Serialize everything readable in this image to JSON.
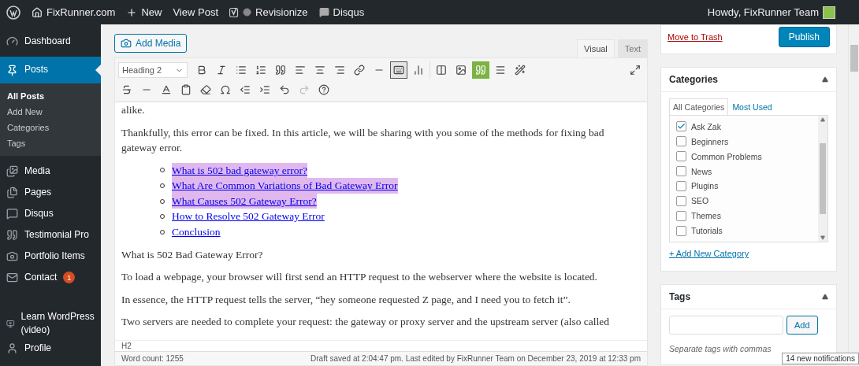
{
  "admin_bar": {
    "site": "FixRunner.com",
    "items": [
      "New",
      "View Post",
      "Revisionize",
      "Disqus"
    ],
    "greeting": "Howdy, FixRunner Team"
  },
  "sidebar": {
    "items": [
      {
        "label": "Dashboard",
        "selected": false
      },
      {
        "label": "Posts",
        "selected": true,
        "children": [
          {
            "label": "All Posts",
            "selected": true
          },
          {
            "label": "Add New",
            "selected": false
          },
          {
            "label": "Categories",
            "selected": false
          },
          {
            "label": "Tags",
            "selected": false
          }
        ]
      },
      {
        "label": "Media",
        "selected": false
      },
      {
        "label": "Pages",
        "selected": false
      },
      {
        "label": "Disqus",
        "selected": false
      },
      {
        "label": "Testimonial Pro",
        "selected": false
      },
      {
        "label": "Portfolio Items",
        "selected": false
      },
      {
        "label": "Contact",
        "selected": false,
        "badge": "1"
      },
      {
        "label": "Learn WordPress (video)",
        "selected": false
      },
      {
        "label": "Profile",
        "selected": false
      }
    ]
  },
  "editor": {
    "add_media": "Add Media",
    "tabs": [
      {
        "label": "Visual",
        "selected": true
      },
      {
        "label": "Text",
        "selected": false
      }
    ],
    "format": "Heading 2",
    "content": [
      {
        "kind": "p",
        "text": "alike."
      },
      {
        "kind": "p",
        "text": "Thankfully, this error can be fixed. In this article, we will be sharing with you some of the methods for fixing bad gateway error."
      },
      {
        "kind": "list",
        "items": [
          {
            "text": "What is 502 bad gateway error?",
            "highlighted": true
          },
          {
            "text": "What Are Common Variations of Bad Gateway Error",
            "highlighted": true
          },
          {
            "text": "What Causes 502 Gateway Error?",
            "highlighted": true
          },
          {
            "text": "How to Resolve 502 Gateway Error",
            "highlighted": false
          },
          {
            "text": "Conclusion",
            "highlighted": false
          }
        ]
      },
      {
        "kind": "p",
        "text": "What is 502 Bad Gateway Error?"
      },
      {
        "kind": "p",
        "text": "To load a webpage, your browser will first send an HTTP request to the webserver where the website is located."
      },
      {
        "kind": "p",
        "text": "In essence, the HTTP request tells the server, “hey someone requested Z page, and I need you to fetch it”."
      },
      {
        "kind": "p",
        "text": "Two servers are needed to complete your request: the gateway or proxy server and the upstream server (also called"
      }
    ],
    "path": "H2",
    "word_count": "Word count: 1255",
    "draft_status": "Draft saved at 2:04:47 pm. Last edited by FixRunner Team on December 23, 2019 at 12:33 pm"
  },
  "publish": {
    "trash": "Move to Trash",
    "button": "Publish"
  },
  "categories": {
    "title": "Categories",
    "tabs": [
      {
        "label": "All Categories",
        "selected": true
      },
      {
        "label": "Most Used",
        "selected": false
      }
    ],
    "items": [
      {
        "label": "Ask Zak",
        "checked": true
      },
      {
        "label": "Beginners",
        "checked": false
      },
      {
        "label": "Common Problems",
        "checked": false
      },
      {
        "label": "News",
        "checked": false
      },
      {
        "label": "Plugins",
        "checked": false
      },
      {
        "label": "SEO",
        "checked": false
      },
      {
        "label": "Themes",
        "checked": false
      },
      {
        "label": "Tutorials",
        "checked": false
      }
    ],
    "add_link": "+ Add New Category"
  },
  "tags": {
    "title": "Tags",
    "button": "Add",
    "hint": "Separate tags with commas"
  },
  "notification": "14 new notifications"
}
